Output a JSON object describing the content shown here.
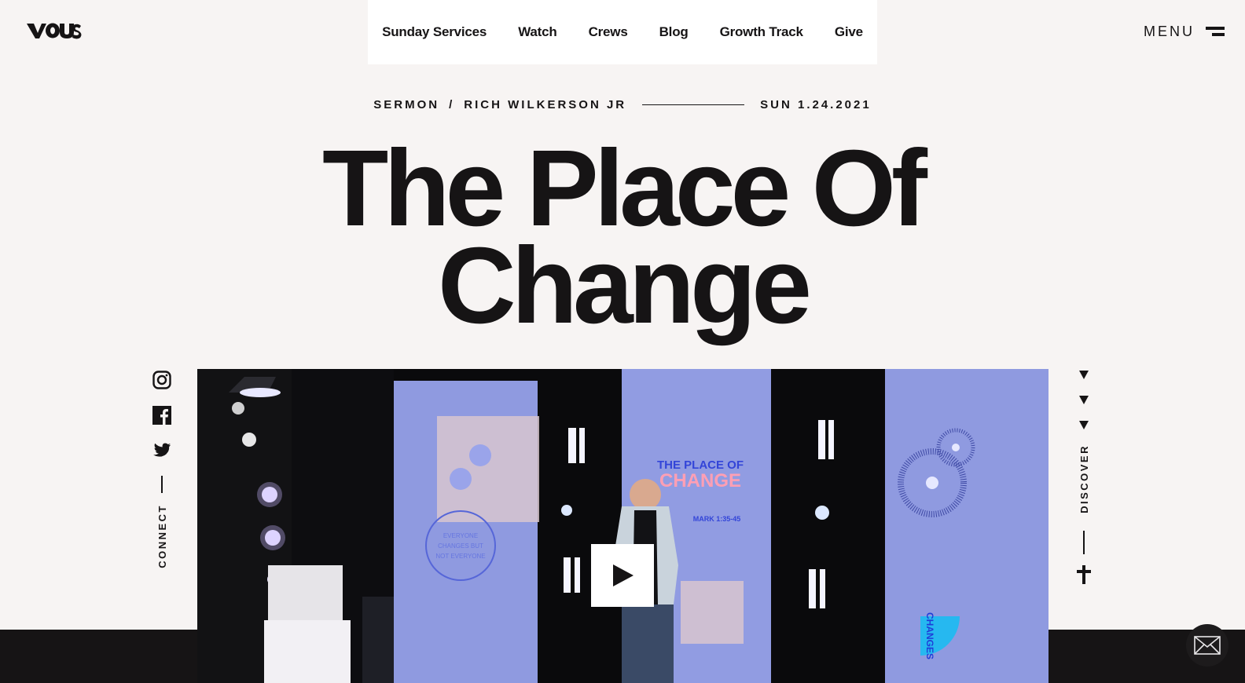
{
  "brand": {
    "logo_text": "VOUS",
    "logo_icon": "vous-logo"
  },
  "nav": {
    "items": [
      {
        "label": "Sunday Services"
      },
      {
        "label": "Watch"
      },
      {
        "label": "Crews"
      },
      {
        "label": "Blog"
      },
      {
        "label": "Growth Track"
      },
      {
        "label": "Give"
      }
    ],
    "menu_label": "MENU",
    "menu_icon": "hamburger-icon"
  },
  "sermon": {
    "category": "SERMON",
    "separator": "/",
    "speaker": "RICH WILKERSON JR",
    "date": "SUN 1.24.2021",
    "title_line1": "The Place Of",
    "title_line2": "Change"
  },
  "social": {
    "icons": [
      "instagram-icon",
      "facebook-icon",
      "twitter-icon"
    ],
    "connect_label": "CONNECT"
  },
  "discover": {
    "label": "DISCOVER",
    "icon": "cross-icon"
  },
  "video": {
    "play_icon": "play-icon",
    "screen_title_line1": "THE PLACE OF",
    "screen_title_line2": "CHANGE",
    "screen_reference": "MARK 1:35-45",
    "screen_side_text": "CHANGES"
  },
  "contact": {
    "icon": "mail-icon"
  },
  "colors": {
    "background": "#f7f4f3",
    "ink": "#161415",
    "nav_bg": "#ffffff",
    "stage_blue": "#8f9ae0"
  }
}
